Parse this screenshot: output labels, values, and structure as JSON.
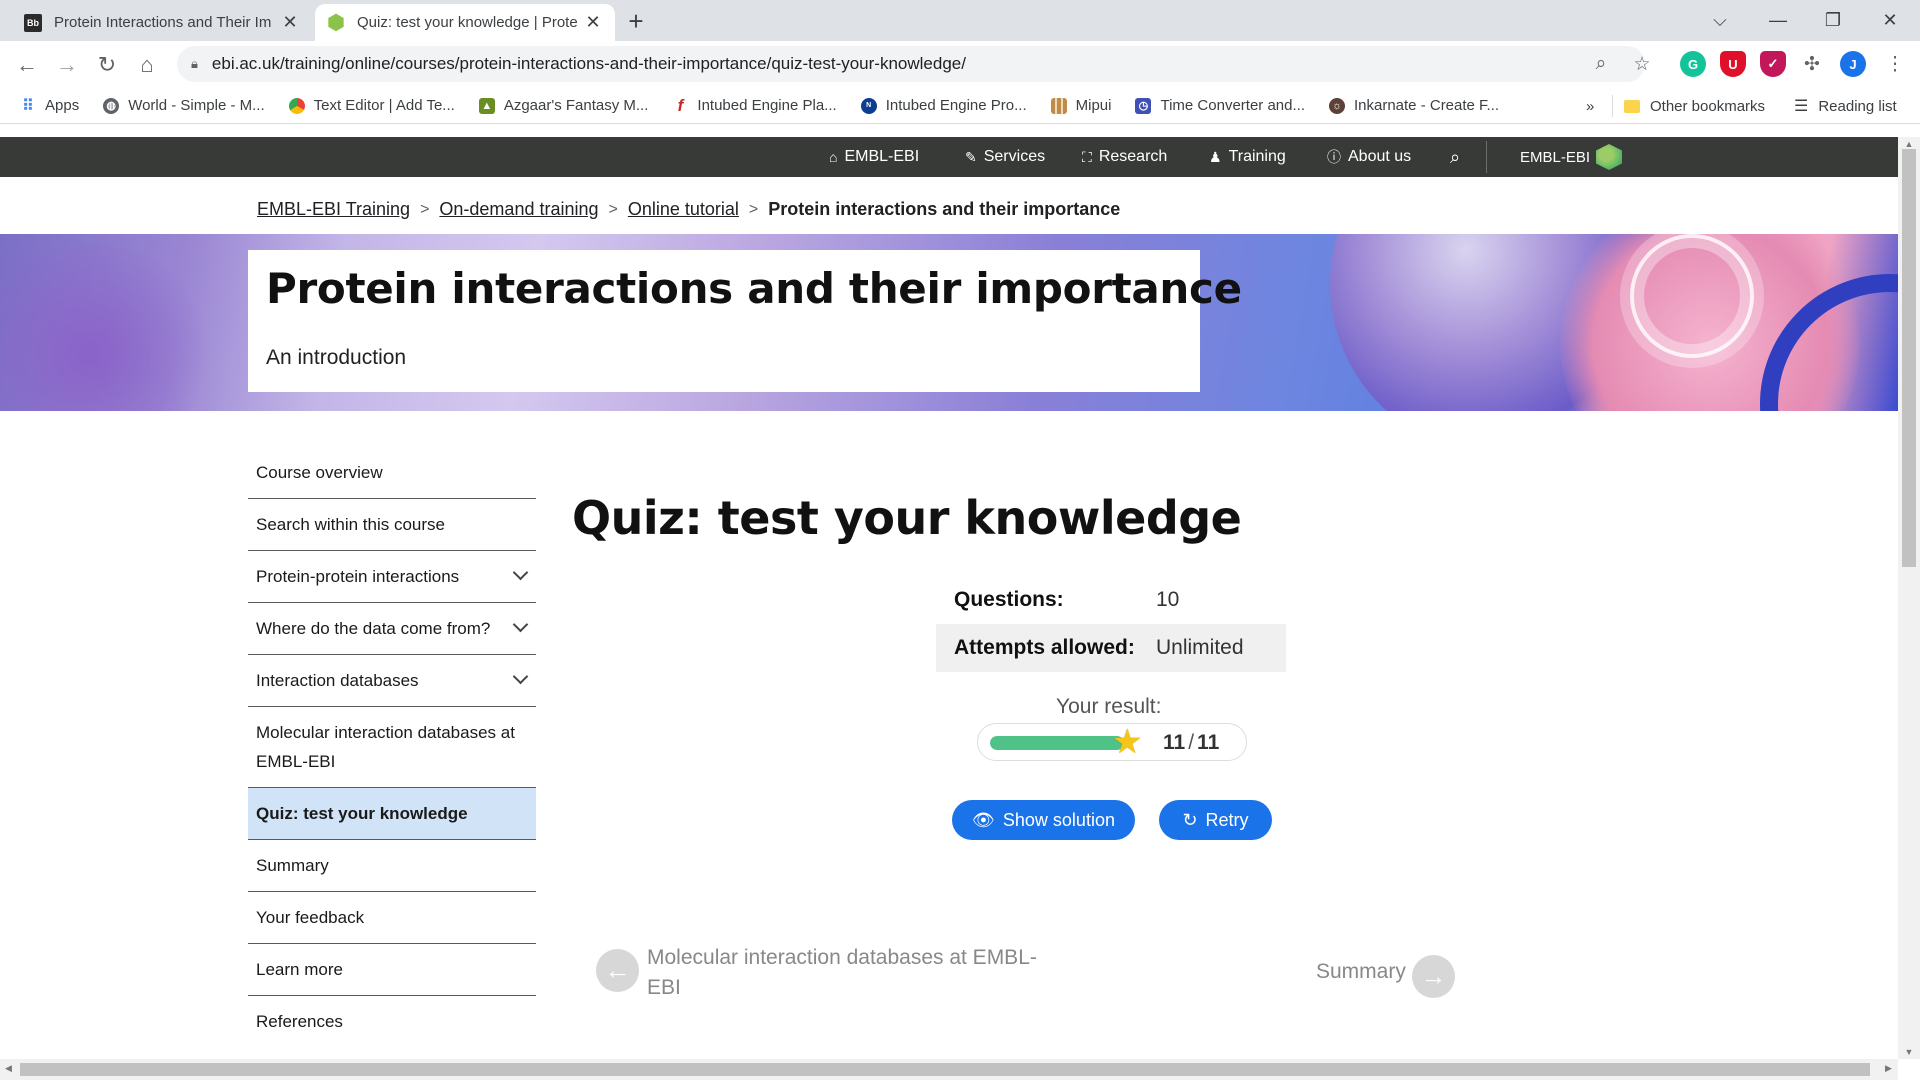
{
  "browser": {
    "tabs": [
      {
        "title": "Protein Interactions and Their Im",
        "favicon": "bb-icon"
      },
      {
        "title": "Quiz: test your knowledge | Prote",
        "favicon": "embl-hex-icon"
      }
    ],
    "url": "ebi.ac.uk/training/online/courses/protein-interactions-and-their-importance/quiz-test-your-knowledge/",
    "profile_initial": "J",
    "bookmarks": [
      {
        "label": "Apps",
        "icon": "apps-grid-icon",
        "color": "#4285f4"
      },
      {
        "label": "World - Simple - M...",
        "icon": "globe-icon",
        "color": "#5f6368"
      },
      {
        "label": "Text Editor | Add Te...",
        "icon": "chrome-icon",
        "color": "#1a73e8"
      },
      {
        "label": "Azgaar's Fantasy M...",
        "icon": "map-icon",
        "color": "#6b8e23"
      },
      {
        "label": "Intubed Engine Pla...",
        "icon": "f-script-icon",
        "color": "#c62828"
      },
      {
        "label": "Intubed Engine Pro...",
        "icon": "nasa-icon",
        "color": "#0b3d91"
      },
      {
        "label": "Mipui",
        "icon": "grid-icon",
        "color": "#a0522d"
      },
      {
        "label": "Time Converter and...",
        "icon": "clock-icon",
        "color": "#3f51b5"
      },
      {
        "label": "Inkarnate - Create F...",
        "icon": "inkarnate-icon",
        "color": "#5d4037"
      }
    ],
    "overflow_label": "»",
    "other_bookmarks": "Other bookmarks",
    "reading_list": "Reading list"
  },
  "masthead": {
    "items": [
      {
        "label": "EMBL-EBI",
        "icon": "home-icon"
      },
      {
        "label": "Services",
        "icon": "wrench-icon"
      },
      {
        "label": "Research",
        "icon": "research-icon"
      },
      {
        "label": "Training",
        "icon": "training-icon"
      },
      {
        "label": "About us",
        "icon": "info-icon"
      }
    ],
    "logo_text": "EMBL-EBI"
  },
  "breadcrumb": {
    "links": [
      "EMBL-EBI Training",
      "On-demand training",
      "Online tutorial"
    ],
    "separator": ">",
    "current": "Protein interactions and their importance"
  },
  "hero": {
    "title": "Protein interactions and their importance",
    "subtitle": "An introduction"
  },
  "sidebar": {
    "items": [
      {
        "label": "Course overview",
        "expandable": false,
        "active": false
      },
      {
        "label": "Search within this course",
        "expandable": false,
        "active": false
      },
      {
        "label": "Protein-protein interactions",
        "expandable": true,
        "active": false
      },
      {
        "label": "Where do the data come from?",
        "expandable": true,
        "active": false
      },
      {
        "label": "Interaction databases",
        "expandable": true,
        "active": false
      },
      {
        "label": "Molecular interaction databases at EMBL-EBI",
        "expandable": false,
        "active": false
      },
      {
        "label": "Quiz: test your knowledge",
        "expandable": false,
        "active": true
      },
      {
        "label": "Summary",
        "expandable": false,
        "active": false
      },
      {
        "label": "Your feedback",
        "expandable": false,
        "active": false
      },
      {
        "label": "Learn more",
        "expandable": false,
        "active": false
      },
      {
        "label": "References",
        "expandable": false,
        "active": false
      }
    ]
  },
  "quiz": {
    "title": "Quiz: test your knowledge",
    "questions_label": "Questions:",
    "questions_value": "10",
    "attempts_label": "Attempts allowed:",
    "attempts_value": "Unlimited",
    "result_label": "Your result:",
    "score": "11",
    "score_sep": "/",
    "total": "11",
    "progress_fraction": 1.0,
    "show_solution_label": "Show solution",
    "retry_label": "Retry",
    "accent_color": "#1a73e8",
    "progress_color": "#4fc287"
  },
  "pager": {
    "prev_label": "Molecular interaction databases at EMBL-EBI",
    "next_label": "Summary"
  }
}
